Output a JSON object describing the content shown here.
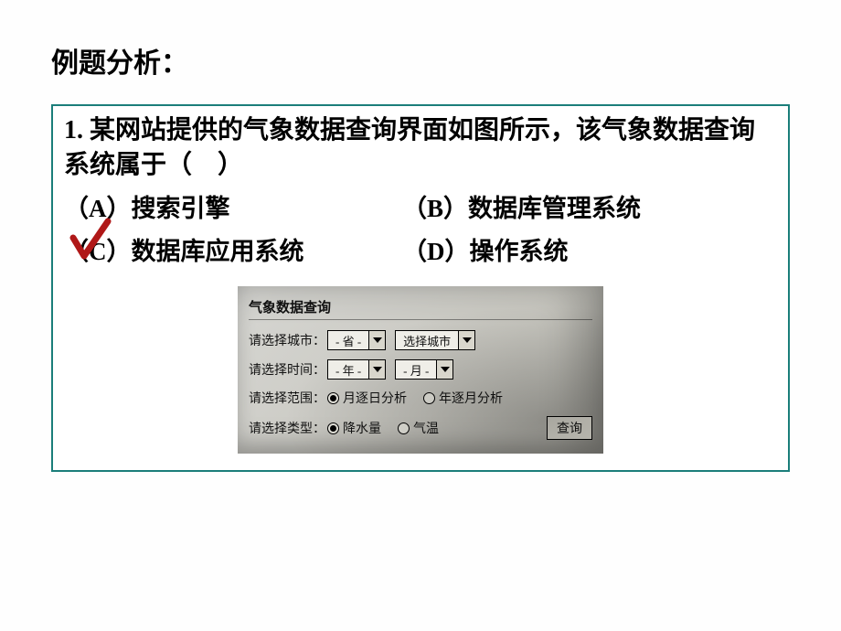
{
  "title": "例题分析：",
  "question": "1. 某网站提供的气象数据查询界面如图所示，该气象数据查询系统属于（　）",
  "options": {
    "A": "（A）搜索引擎",
    "B": "（B）数据库管理系统",
    "C": "（C）数据库应用系统",
    "D": "（D）操作系统"
  },
  "correct": "C",
  "panel": {
    "title": "气象数据查询",
    "row_city_label": "请选择城市：",
    "city_province": "- 省 -",
    "city_city": "选择城市",
    "row_time_label": "请选择时间：",
    "time_year": "- 年 -",
    "time_month": "- 月 -",
    "row_scope_label": "请选择范围：",
    "scope_opt1": "月逐日分析",
    "scope_opt2": "年逐月分析",
    "row_type_label": "请选择类型：",
    "type_opt1": "降水量",
    "type_opt2": "气温",
    "query_btn": "查询",
    "scope_selected": 1,
    "type_selected": 1
  }
}
